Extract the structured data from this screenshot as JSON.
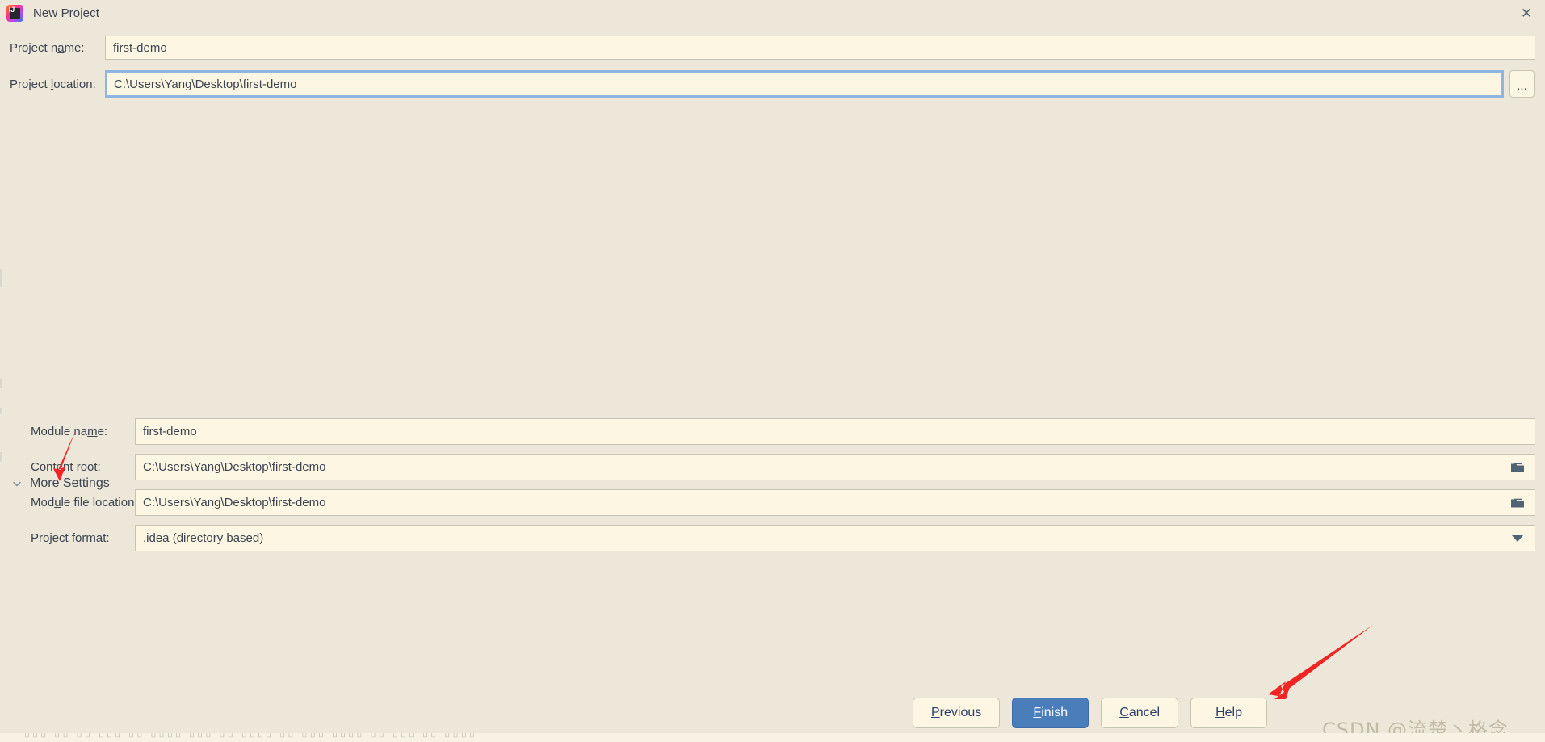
{
  "window": {
    "title": "New Project",
    "app_icon": "intellij-idea-icon",
    "close_icon": "close-icon",
    "background_color": "#ece7d8",
    "field_background_color": "#fdf6e3",
    "accent_color": "#4a7ebb",
    "text_color": "#3c4450"
  },
  "form": {
    "project_name": {
      "label_pre": "Project n",
      "label_mnemonic": "a",
      "label_post": "me:",
      "value": "first-demo"
    },
    "project_location": {
      "label_pre": "Project ",
      "label_mnemonic": "l",
      "label_post": "ocation:",
      "value": "C:\\Users\\Yang\\Desktop\\first-demo",
      "focused": true,
      "browse_button_label": "..."
    }
  },
  "more_settings": {
    "label_pre": "Mor",
    "label_mnemonic": "e",
    "label_post": " Settings",
    "expanded": true,
    "chevron_icon": "chevron-down-icon"
  },
  "settings": [
    {
      "name": "module-name",
      "label_pre": "Module na",
      "label_mnemonic": "m",
      "label_post": "e:",
      "value": "first-demo",
      "trailing_icon": "none"
    },
    {
      "name": "content-root",
      "label_pre": "Content r",
      "label_mnemonic": "o",
      "label_post": "ot:",
      "value": "C:\\Users\\Yang\\Desktop\\first-demo",
      "trailing_icon": "folder-icon"
    },
    {
      "name": "module-file-location",
      "label_pre": "Mod",
      "label_mnemonic": "u",
      "label_post": "le file location:",
      "value": "C:\\Users\\Yang\\Desktop\\first-demo",
      "trailing_icon": "folder-icon"
    },
    {
      "name": "project-format",
      "label_pre": "Project ",
      "label_mnemonic": "f",
      "label_post": "ormat:",
      "value": ".idea (directory based)",
      "trailing_icon": "caret-down-icon"
    }
  ],
  "buttons": [
    {
      "name": "previous",
      "label_pre": "",
      "label_mnemonic": "P",
      "label_post": "revious",
      "primary": false
    },
    {
      "name": "finish",
      "label_pre": "",
      "label_mnemonic": "F",
      "label_post": "inish",
      "primary": true
    },
    {
      "name": "cancel",
      "label_pre": "",
      "label_mnemonic": "C",
      "label_post": "ancel",
      "primary": false
    },
    {
      "name": "help",
      "label_pre": "",
      "label_mnemonic": "H",
      "label_post": "elp",
      "primary": false
    }
  ],
  "annotations": {
    "arrow_color": "#f22424",
    "arrow_more_settings_target": "More Settings",
    "arrow_finish_target": "Finish"
  },
  "watermark": {
    "text": "CSDN @流楚丶格念"
  }
}
